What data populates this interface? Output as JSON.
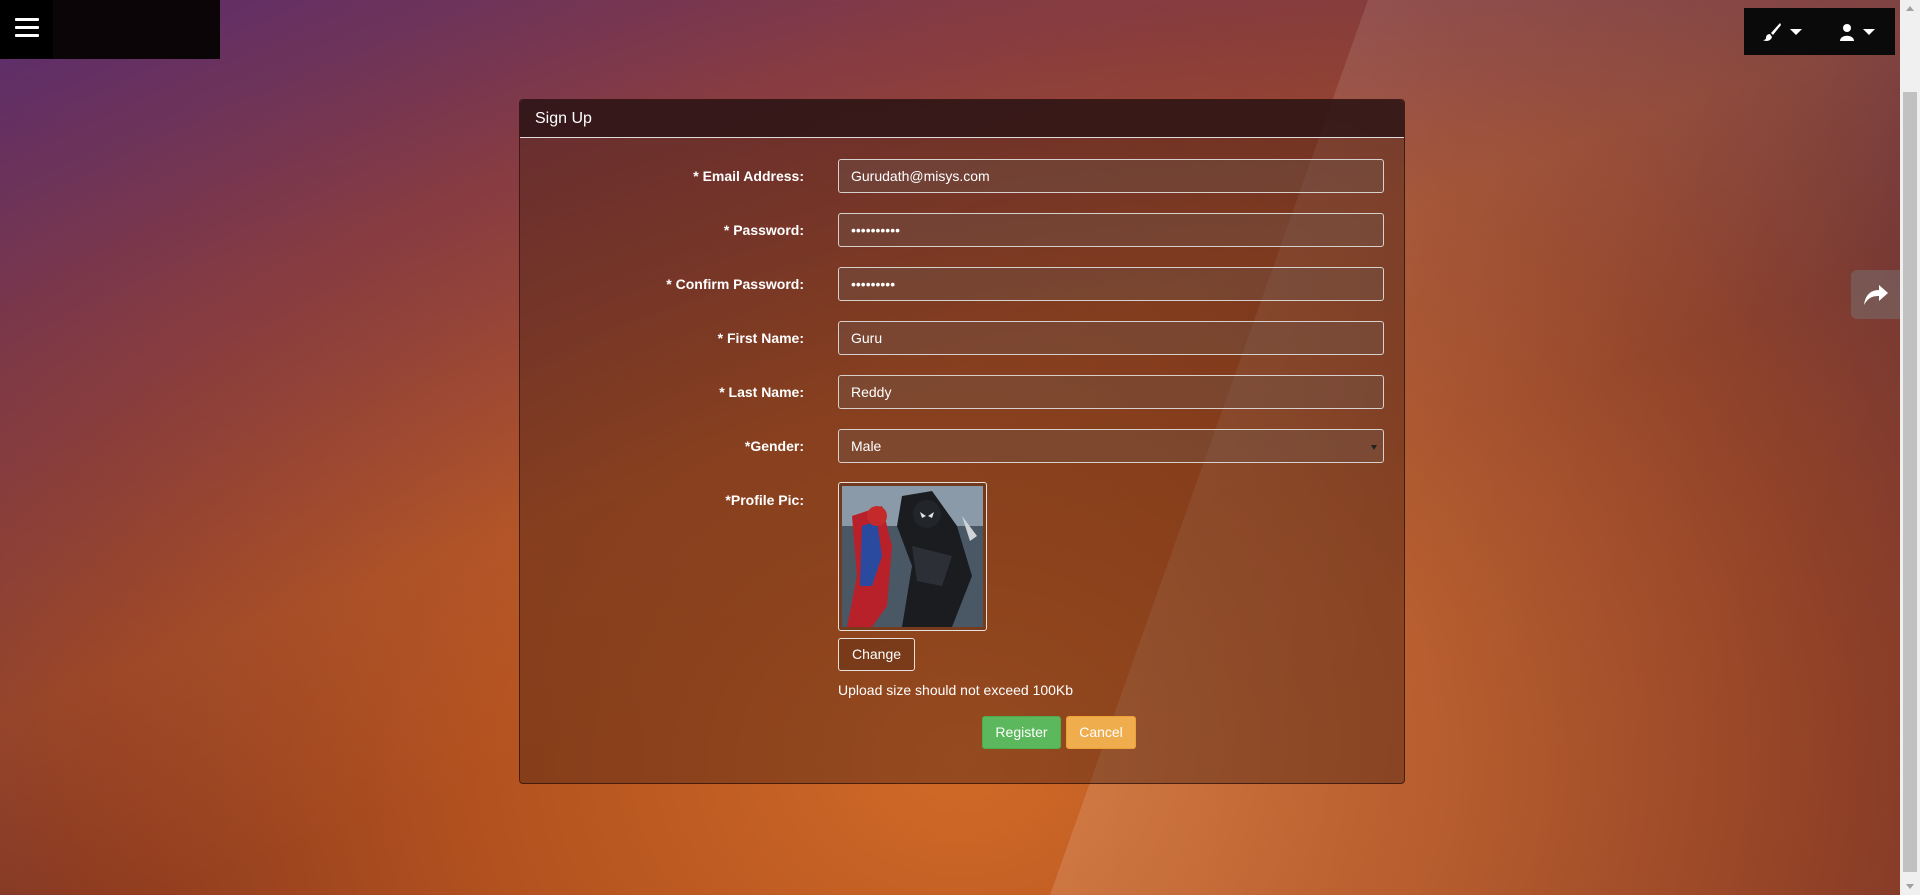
{
  "header": {
    "menu_icon": "hamburger-icon",
    "theme_icon": "brush-icon",
    "user_icon": "user-icon"
  },
  "side": {
    "share_icon": "share-arrow-icon"
  },
  "panel": {
    "title": "Sign Up"
  },
  "form": {
    "email": {
      "label": "* Email Address:",
      "value": "Gurudath@misys.com"
    },
    "password": {
      "label": "* Password:",
      "value": "••••••••••"
    },
    "confirm_password": {
      "label": "* Confirm Password:",
      "value": "•••••••••"
    },
    "first_name": {
      "label": "* First Name:",
      "value": "Guru"
    },
    "last_name": {
      "label": "* Last Name:",
      "value": "Reddy"
    },
    "gender": {
      "label": "*Gender:",
      "value": "Male"
    },
    "profile_pic": {
      "label": "*Profile Pic:",
      "change_label": "Change",
      "hint": "Upload size should not exceed 100Kb"
    }
  },
  "actions": {
    "register_label": "Register",
    "cancel_label": "Cancel"
  },
  "colors": {
    "register": "#5cb85c",
    "cancel": "#f0ad4e"
  }
}
